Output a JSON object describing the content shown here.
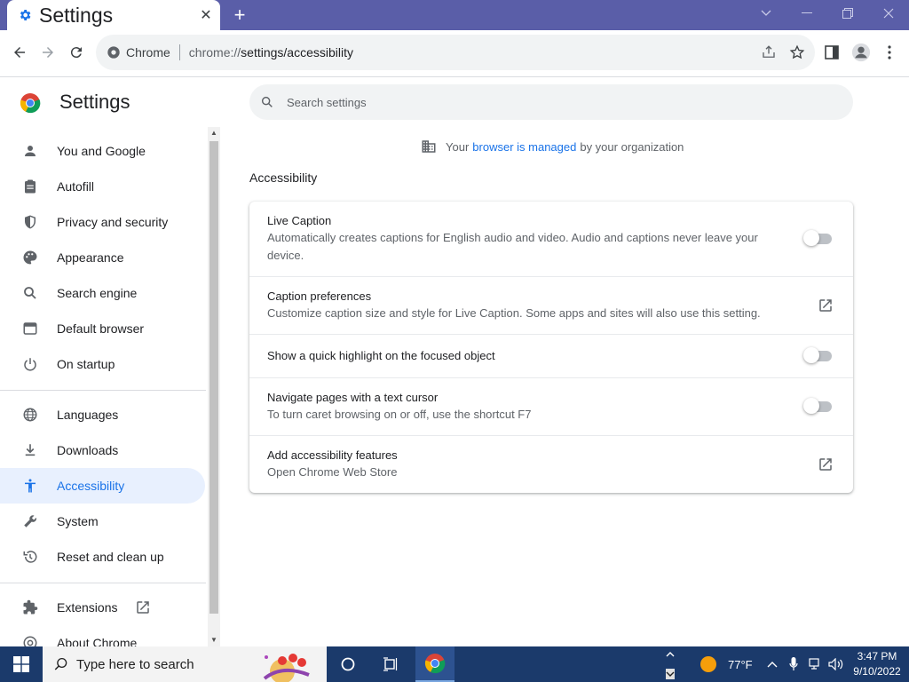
{
  "browser": {
    "tab_title": "Settings",
    "omnibox_site": "Chrome",
    "omnibox_scheme": "chrome://",
    "omnibox_path": "settings/accessibility"
  },
  "header": {
    "title": "Settings",
    "search_placeholder": "Search settings"
  },
  "managed": {
    "prefix": "Your",
    "link": "browser is managed",
    "suffix": "by your organization"
  },
  "sidebar": {
    "items": [
      {
        "label": "You and Google",
        "icon": "person-icon"
      },
      {
        "label": "Autofill",
        "icon": "clipboard-icon"
      },
      {
        "label": "Privacy and security",
        "icon": "shield-icon"
      },
      {
        "label": "Appearance",
        "icon": "palette-icon"
      },
      {
        "label": "Search engine",
        "icon": "search-icon"
      },
      {
        "label": "Default browser",
        "icon": "browser-icon"
      },
      {
        "label": "On startup",
        "icon": "power-icon"
      },
      {
        "label": "Languages",
        "icon": "globe-icon"
      },
      {
        "label": "Downloads",
        "icon": "download-icon"
      },
      {
        "label": "Accessibility",
        "icon": "accessibility-icon",
        "active": true
      },
      {
        "label": "System",
        "icon": "wrench-icon"
      },
      {
        "label": "Reset and clean up",
        "icon": "restore-icon"
      },
      {
        "label": "Extensions",
        "icon": "puzzle-icon"
      },
      {
        "label": "About Chrome",
        "icon": "chrome-icon"
      }
    ]
  },
  "main": {
    "section_title": "Accessibility",
    "rows": [
      {
        "label": "Live Caption",
        "sub": "Automatically creates captions for English audio and video. Audio and captions never leave your device.",
        "control": "toggle",
        "on": false
      },
      {
        "label": "Caption preferences",
        "sub": "Customize caption size and style for Live Caption. Some apps and sites will also use this setting.",
        "control": "external-link"
      },
      {
        "label": "Show a quick highlight on the focused object",
        "sub": "",
        "control": "toggle",
        "on": false
      },
      {
        "label": "Navigate pages with a text cursor",
        "sub": "To turn caret browsing on or off, use the shortcut F7",
        "control": "toggle",
        "on": false
      },
      {
        "label": "Add accessibility features",
        "sub": "Open Chrome Web Store",
        "control": "external-link"
      }
    ]
  },
  "taskbar": {
    "search_placeholder": "Type here to search",
    "weather": "77°F",
    "time": "3:47 PM",
    "date": "9/10/2022"
  },
  "colors": {
    "accent": "#1a73e8",
    "tabstrip": "#5a5ea8",
    "taskbar": "#1b3a6b"
  }
}
